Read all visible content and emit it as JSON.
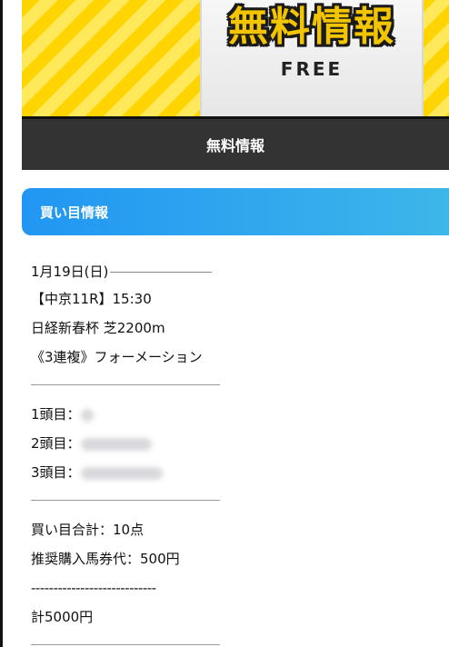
{
  "banner": {
    "title": "無料情報",
    "subtitle": "FREE"
  },
  "caption": "無料情報",
  "section": {
    "title": "買い目情報"
  },
  "race": {
    "date": "1月19日(日)",
    "venue_time": "【中京11R】15:30",
    "race_name": "日経新春杯 芝2200m",
    "bet_type": "《3連複》フォーメーション"
  },
  "picks": [
    {
      "label": "1頭目："
    },
    {
      "label": "2頭目："
    },
    {
      "label": "3頭目："
    }
  ],
  "summary": {
    "total_points": "買い目合計：10点",
    "recommended_amount": "推奨購入馬券代：500円",
    "dashes": "----------------------------",
    "total": "計5000円"
  },
  "colors": {
    "banner_yellow": "#ffd400",
    "caption_bg": "#333333",
    "header_gradient_start": "#2196f3",
    "header_gradient_end": "#3db6ea"
  }
}
